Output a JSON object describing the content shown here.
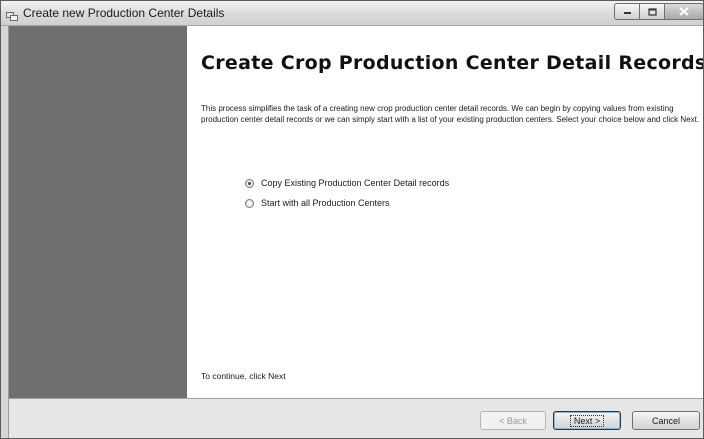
{
  "window": {
    "title": "Create new Production Center Details"
  },
  "page": {
    "heading": "Create Crop Production Center Detail Records",
    "description": "This process simplifies the task of  a creating new crop production center detail records.  We can begin by copying values from existing production center detail records or we can simply start with a list of your existing production centers.  Select your choice below and click Next.",
    "options": [
      {
        "label": "Copy Existing Production Center Detail records",
        "checked": true
      },
      {
        "label": "Start with all Production Centers",
        "checked": false
      }
    ],
    "continue_text": "To continue, click Next"
  },
  "footer": {
    "back_label": "< Back",
    "next_label": "Next >",
    "cancel_label": "Cancel"
  },
  "icons": {
    "app": "window-icon",
    "minimize": "minimize-icon",
    "maximize": "maximize-icon",
    "close": "close-icon"
  }
}
